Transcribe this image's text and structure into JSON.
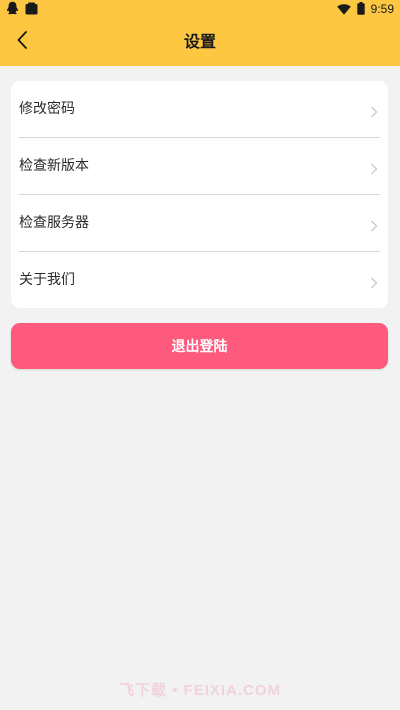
{
  "status_bar": {
    "time": "9:59"
  },
  "header": {
    "title": "设置"
  },
  "menu": {
    "items": [
      {
        "label": "修改密码"
      },
      {
        "label": "检查新版本"
      },
      {
        "label": "检查服务器"
      },
      {
        "label": "关于我们"
      }
    ]
  },
  "logout": {
    "label": "退出登陆"
  },
  "watermark": {
    "text": "飞下载 • FEIXIA.COM"
  },
  "colors": {
    "header_bg": "#fdc741",
    "page_bg": "#f2f2f2",
    "logout_bg": "#fe5a7d",
    "card_bg": "#ffffff"
  },
  "icons": {
    "back": "chevron-left-icon",
    "chevron": "chevron-right-icon",
    "wifi": "wifi-icon",
    "battery": "battery-icon",
    "qq": "qq-notification-icon",
    "app": "app-notification-icon"
  }
}
